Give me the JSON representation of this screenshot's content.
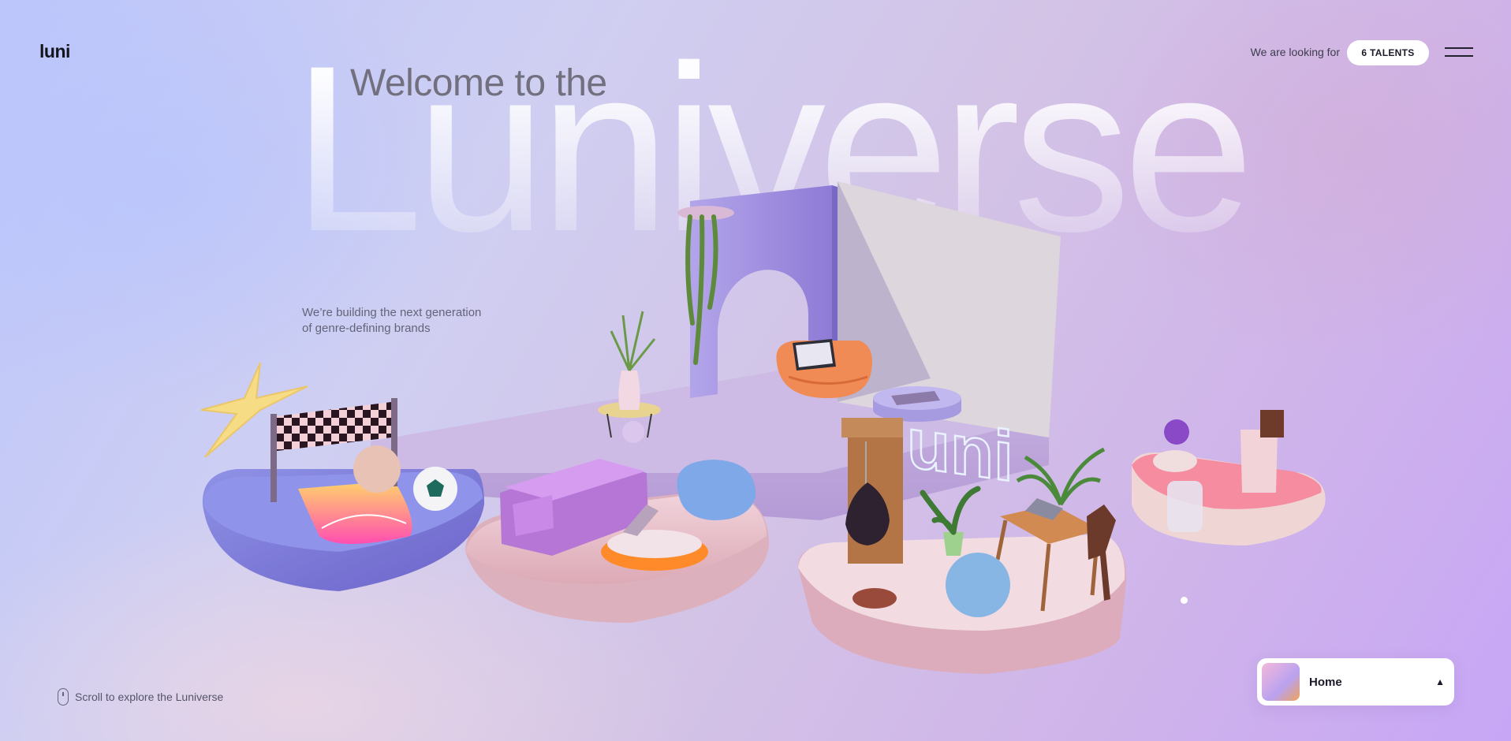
{
  "header": {
    "logo": "luni",
    "looking_text": "We are looking for",
    "talents_button": "6 TALENTS"
  },
  "hero": {
    "welcome": "Welcome to the",
    "big_word": "Luniverse",
    "tagline_line1": "We’re building the next generation",
    "tagline_line2": "of genre-defining brands"
  },
  "scene": {
    "neon_sign": "luni"
  },
  "footer": {
    "scroll_hint": "Scroll to explore the Luniverse"
  },
  "nav_card": {
    "label": "Home",
    "caret": "▲"
  }
}
